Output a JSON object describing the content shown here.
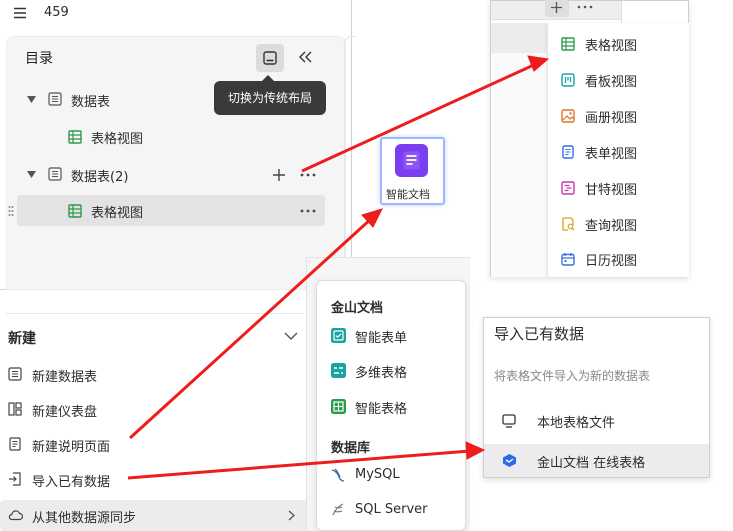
{
  "top_bar": {
    "menu_icon": "hamburger-icon",
    "title": "459"
  },
  "catalog": {
    "title": "目录",
    "tooltip": "切换为传统布局",
    "tree": [
      {
        "label": "数据表",
        "type": "table",
        "expanded": true
      },
      {
        "label": "表格视图",
        "type": "grid-view"
      },
      {
        "label": "数据表(2)",
        "type": "table",
        "expanded": true
      },
      {
        "label": "表格视图",
        "type": "grid-view",
        "selected": true
      }
    ]
  },
  "doc_card": {
    "label": "智能文档",
    "icon": "smart-doc-icon",
    "color": "#7a3df0"
  },
  "views_menu": {
    "items": [
      {
        "label": "表格视图",
        "icon": "grid-view-icon",
        "color": "#2e9a4c"
      },
      {
        "label": "看板视图",
        "icon": "kanban-view-icon",
        "color": "#1aa3a3"
      },
      {
        "label": "画册视图",
        "icon": "gallery-view-icon",
        "color": "#e0722a"
      },
      {
        "label": "表单视图",
        "icon": "form-view-icon",
        "color": "#3c6fe0"
      },
      {
        "label": "甘特视图",
        "icon": "gantt-view-icon",
        "color": "#c43aa8"
      },
      {
        "label": "查询视图",
        "icon": "query-view-icon",
        "color": "#d9a21c"
      },
      {
        "label": "日历视图",
        "icon": "calendar-view-icon",
        "color": "#3c6fe0"
      }
    ]
  },
  "new_panel": {
    "header": "新建",
    "items": [
      {
        "label": "新建数据表",
        "icon": "datatable-icon"
      },
      {
        "label": "新建仪表盘",
        "icon": "dashboard-icon"
      },
      {
        "label": "新建说明页面",
        "icon": "doc-page-icon"
      },
      {
        "label": "导入已有数据",
        "icon": "import-icon"
      },
      {
        "label": "从其他数据源同步",
        "icon": "cloud-icon"
      }
    ]
  },
  "source_menu": {
    "group1": "金山文档",
    "group1_items": [
      {
        "label": "智能表单",
        "icon": "smart-form-icon",
        "color": "#1aa3a3"
      },
      {
        "label": "多维表格",
        "icon": "multi-table-icon",
        "color": "#1aa3a3"
      },
      {
        "label": "智能表格",
        "icon": "smart-sheet-icon",
        "color": "#2e9a4c"
      }
    ],
    "group2": "数据库",
    "group2_items": [
      {
        "label": "MySQL",
        "icon": "mysql-icon"
      },
      {
        "label": "SQL Server",
        "icon": "sqlserver-icon"
      }
    ]
  },
  "import_panel": {
    "title": "导入已有数据",
    "subtitle": "将表格文件导入为新的数据表",
    "items": [
      {
        "label": "本地表格文件",
        "icon": "monitor-icon"
      },
      {
        "label": "金山文档 在线表格",
        "icon": "kdocs-icon"
      }
    ]
  },
  "colors": {
    "arrow": "#ee1c1c",
    "tooltip_bg": "#3a3a3c",
    "selected_row": "#e3e3e5"
  }
}
